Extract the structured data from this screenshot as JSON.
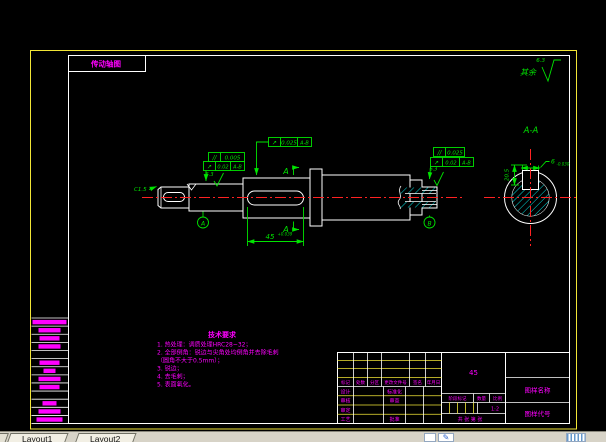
{
  "colors": {
    "yellow": "#f2e636",
    "green": "#00e400",
    "magenta": "#ff00ff",
    "red": "#ff2222",
    "cyan": "#00dcdc",
    "white": "#ffffff"
  },
  "corner_label": "传动轴图",
  "surface": {
    "rest_label": "其余",
    "rest_value": "6.3",
    "mark1": "6.3",
    "mark2": "6.3"
  },
  "section": {
    "label": "A-A",
    "arrow_top": "A",
    "arrow_bottom": "A"
  },
  "datums": {
    "left": "A",
    "right": "B"
  },
  "frames": {
    "f1": {
      "r1_sym": "//",
      "r1_val": "0.005",
      "r2_sym": "↗",
      "r2_val": "0.02",
      "r2_dat": "A-B"
    },
    "f2": {
      "sym": "↗",
      "val": "0.025",
      "dat": "A-B"
    },
    "f3": {
      "r1_sym": "//",
      "r1_val": "0.025",
      "r2_sym": "↗",
      "r2_val": "0.02",
      "r2_dat": "A-B"
    }
  },
  "dims": {
    "chamfer": "C1.5",
    "len": "45",
    "len_tol": "+0.039",
    "kw_width": "6",
    "kw_tol": "-0.030",
    "kw_depth": "20.5"
  },
  "tech": {
    "title": "技术要求",
    "lines": [
      "1. 热处理：调质处理HRC28~32；",
      "2. 全部倒角：锐边与尖角处均倒角并去除毛刺",
      "（圆角不大于0.5mm）；",
      "3. 锐边；",
      "4. 去毛刺；",
      "5. 表面氧化。"
    ]
  },
  "titleblock": {
    "material": "45",
    "header": [
      "标记",
      "处数",
      "分区",
      "更改文件号",
      "签名",
      "年月日"
    ],
    "rows": [
      "设计",
      "审核",
      "审定",
      "工艺"
    ],
    "rows2": [
      "标准化",
      "审查",
      "批准"
    ],
    "stage": "阶段标记",
    "qty": "数量",
    "scale": "比例",
    "scale_val": "1:2",
    "sheet": "共 张 第 张",
    "name": "图样名称",
    "code": "图样代号"
  },
  "tabs": {
    "t1": "Layout1",
    "t2": "Layout2"
  },
  "left_strip": {
    "blocks": [
      34,
      22,
      20,
      22,
      0,
      20,
      12,
      22,
      20,
      0,
      14,
      22,
      26
    ]
  }
}
